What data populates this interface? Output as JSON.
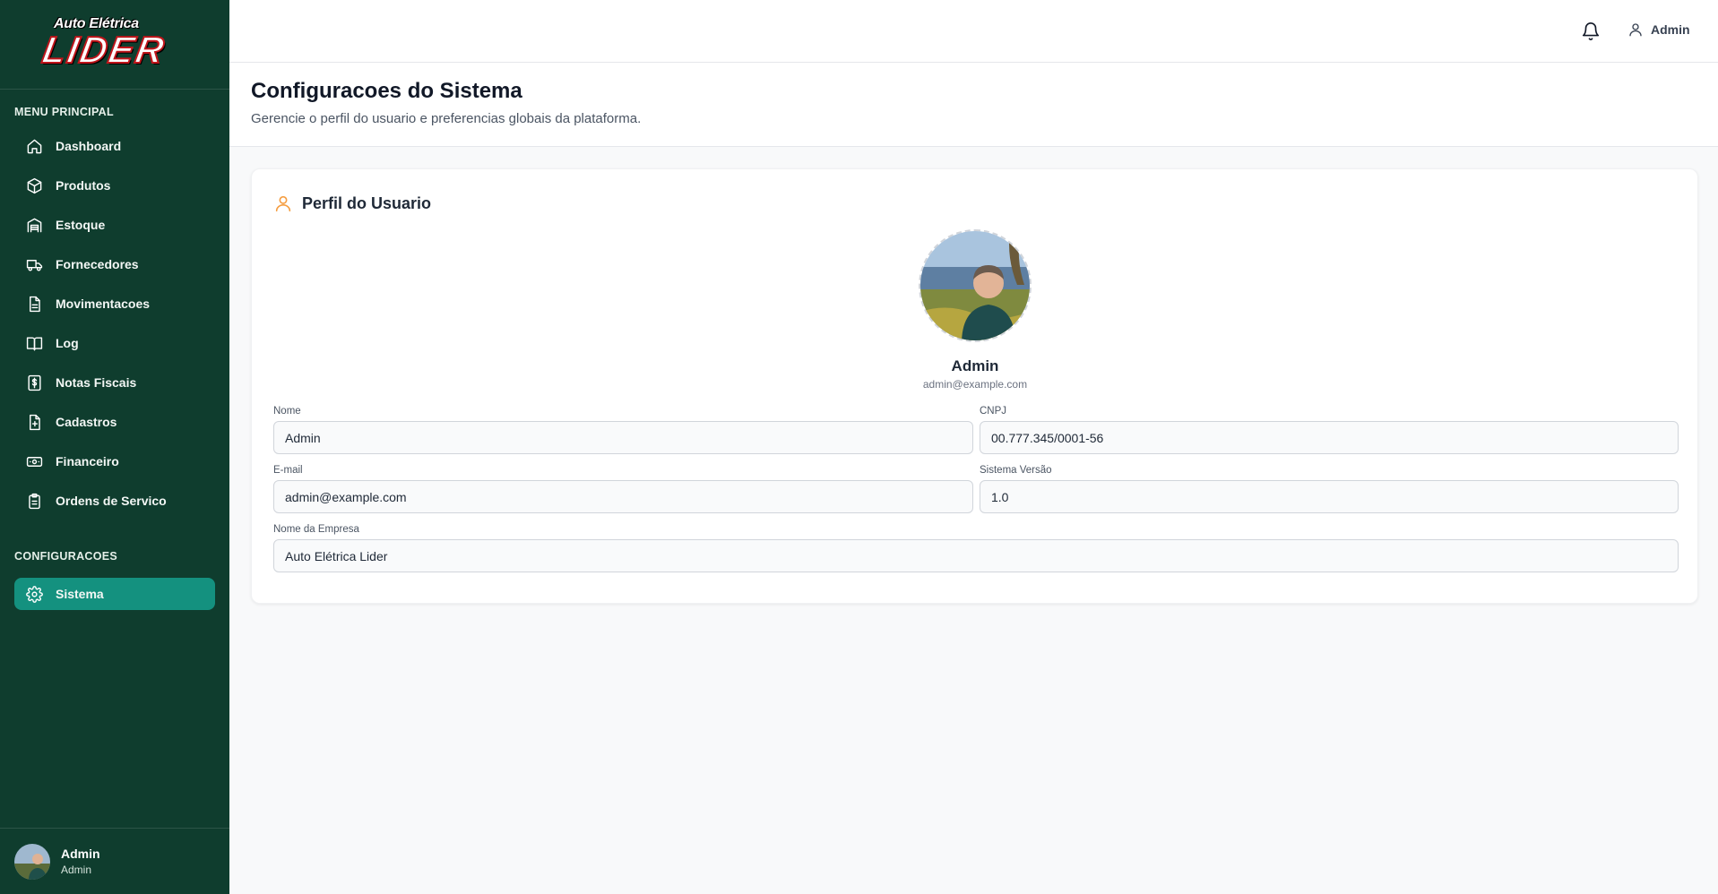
{
  "brand": {
    "logo_top": "Auto Elétrica",
    "logo_main": "LIDER"
  },
  "sidebar": {
    "section_main": "MENU PRINCIPAL",
    "items": [
      {
        "label": "Dashboard",
        "icon": "home-icon"
      },
      {
        "label": "Produtos",
        "icon": "package-icon"
      },
      {
        "label": "Estoque",
        "icon": "warehouse-icon"
      },
      {
        "label": "Fornecedores",
        "icon": "truck-icon"
      },
      {
        "label": "Movimentacoes",
        "icon": "document-icon"
      },
      {
        "label": "Log",
        "icon": "book-icon"
      },
      {
        "label": "Notas Fiscais",
        "icon": "dollar-file-icon"
      },
      {
        "label": "Cadastros",
        "icon": "file-plus-icon"
      },
      {
        "label": "Financeiro",
        "icon": "cash-icon"
      },
      {
        "label": "Ordens de Servico",
        "icon": "clipboard-icon"
      }
    ],
    "section_config": "CONFIGURACOES",
    "config_items": [
      {
        "label": "Sistema",
        "icon": "gear-icon",
        "active": true
      }
    ],
    "user": {
      "name": "Admin",
      "role": "Admin"
    }
  },
  "topbar": {
    "user_label": "Admin"
  },
  "header": {
    "title": "Configuracoes do Sistema",
    "subtitle": "Gerencie o perfil do usuario e preferencias globais da plataforma."
  },
  "profile": {
    "card_title": "Perfil do Usuario",
    "name": "Admin",
    "email": "admin@example.com",
    "fields": {
      "nome": {
        "label": "Nome",
        "value": "Admin"
      },
      "cnpj": {
        "label": "CNPJ",
        "value": "00.777.345/0001-56"
      },
      "email": {
        "label": "E-mail",
        "value": "admin@example.com"
      },
      "versao": {
        "label": "Sistema Versão",
        "value": "1.0"
      },
      "empresa": {
        "label": "Nome da Empresa",
        "value": "Auto Elétrica Lider"
      }
    }
  },
  "colors": {
    "sidebar_bg": "#0f3d2e",
    "active_item": "#14917f",
    "accent_icon": "#f59e42"
  }
}
